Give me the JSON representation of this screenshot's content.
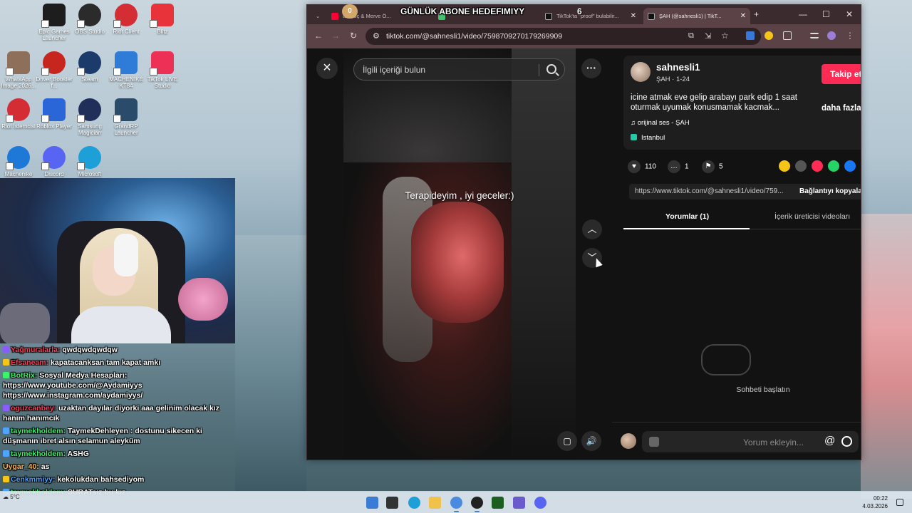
{
  "desktop": {
    "icons": [
      {
        "label": "Epic Games Launcher",
        "color": "#1d1d1d"
      },
      {
        "label": "OBS Studio",
        "color": "#2b2b2b"
      },
      {
        "label": "Riot Client",
        "color": "#d42d34"
      },
      {
        "label": "Blitz",
        "color": "#e8333a"
      },
      {
        "label": "WhatsApp Image 2026...",
        "color": "#8d6f5a"
      },
      {
        "label": "Driver Booster f...",
        "color": "#c6261d"
      },
      {
        "label": "Steam",
        "color": "#1b3b6b"
      },
      {
        "label": "MACHENIKE KT84",
        "color": "#2f7bd8"
      },
      {
        "label": "TikTok LIVE Studio",
        "color": "#ec3056"
      },
      {
        "label": "Riot İstemcisi",
        "color": "#d42d34"
      },
      {
        "label": "Roblox Player",
        "color": "#2a66d8"
      },
      {
        "label": "Samsung Magician",
        "color": "#1f2f5a"
      },
      {
        "label": "GrandRP Launcher",
        "color": "#2b4b6a"
      },
      {
        "label": "Machenike",
        "color": "#1e78d8"
      },
      {
        "label": "Discord",
        "color": "#5865f2"
      },
      {
        "label": "Microsoft",
        "color": "#1da0d8"
      }
    ]
  },
  "overlay": {
    "left_count": "0",
    "title": "GÜNLÜK ABONE HEDEFIMIYY",
    "right_count": "6"
  },
  "chat": {
    "messages": [
      {
        "user": "Yağmuralarla:",
        "text": "qwdqwdqwdqw",
        "color": "#ff3b57"
      },
      {
        "user": "Efsaneam:",
        "text": "kapatacanksan tam kapat amkı",
        "color": "#ff3b57"
      },
      {
        "user": "BotRix:",
        "text": "Sosyal Medya Hesapları: https://www.youtube.com/@Aydamiyys https://www.instagram.com/aydamiyys/",
        "color": "#3cf26a"
      },
      {
        "user": "oguzcanbey:",
        "text": "uzaktan dayılar diyorki aaa gelinim olacak kız hanım hanımcık",
        "color": "#ff3b57"
      },
      {
        "user": "taymekholdem:",
        "text": "TaymekDehleyen : dostunu sikecen ki düşmanın ibret alsın selamun aleyküm",
        "color": "#3cf26a"
      },
      {
        "user": "taymekholdem:",
        "text": "ASHG",
        "color": "#3cf26a"
      },
      {
        "user": "Uygar_40:",
        "text": "as",
        "color": "#ffb84a"
      },
      {
        "user": "Cenkmmiyy:",
        "text": "kekolukdan bahsediyom",
        "color": "#4ea3ff"
      },
      {
        "user": "taymekholdem:",
        "text": "SURATsız bu kız",
        "color": "#3cf26a"
      }
    ]
  },
  "taskbar": {
    "weather": "5°C",
    "time": "00:22",
    "date": "4.03.2026"
  },
  "browser": {
    "tabs": [
      {
        "title": "an Koç & Merve Ö...",
        "fav_color": "#ff0033"
      },
      {
        "title": "",
        "fav_color": "#3ec46d"
      },
      {
        "title": "TikTok'ta \"proof\" bulabilir...",
        "fav_color": "#111111"
      },
      {
        "title": "ŞAH (@sahnesli1) | TikT...",
        "fav_color": "#111111"
      }
    ],
    "url": "tiktok.com/@sahnesli1/video/7598709270179269909",
    "new_tab": "+"
  },
  "tiktok": {
    "search_placeholder": "İlgili içeriği bulun",
    "video_caption": "Terapideyim , iyi geceler:)",
    "author": {
      "username": "sahnesli1",
      "nickname": "ŞAH · 1-24",
      "follow_label": "Takip et",
      "description": "icine atmak eve gelip arabayı park edip 1 saat oturmak uyumak konusmamak kacmak...",
      "more_label": "daha fazla",
      "music": "orijinal ses - ŞAH",
      "location": "Istanbul"
    },
    "stats": {
      "likes": "110",
      "comments": "1",
      "saves": "5"
    },
    "share_colors": [
      "#f5c518",
      "#555555",
      "#fe2c55",
      "#25d366",
      "#1877f2"
    ],
    "link": {
      "url": "https://www.tiktok.com/@sahnesli1/video/759...",
      "copy_label": "Bağlantıyı kopyala"
    },
    "tabs": {
      "comments": "Yorumlar (1)",
      "creator_videos": "İçerik üreticisi videoları"
    },
    "empty_comments": "Sohbeti başlatın",
    "comment_placeholder": "Yorum ekleyin..."
  }
}
